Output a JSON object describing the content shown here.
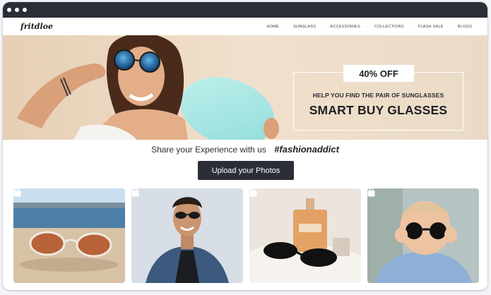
{
  "window": {
    "controls": [
      "dot",
      "dot",
      "dot"
    ]
  },
  "brand": {
    "logo": "fritdloe"
  },
  "nav": {
    "items": [
      "HOME",
      "SUNGLASS",
      "ACCESSORIES",
      "COLLECTIONS",
      "FLASH SALE",
      "BLOGS"
    ],
    "separator": "-"
  },
  "hero": {
    "discount": "40% OFF",
    "subtitle": "HELP YOU FIND THE PAIR OF SUNGLASSES",
    "title": "SMART BUY GLASSES"
  },
  "share": {
    "text": "Share your Experience with us",
    "hashtag": "#fashionaddict",
    "upload_label": "Upload your Photos"
  },
  "gallery": {
    "photos": [
      {
        "subject": "beach-sunglasses",
        "icon": "shopping-bag-icon"
      },
      {
        "subject": "man-sunglasses",
        "icon": "shopping-bag-icon"
      },
      {
        "subject": "perfume-sunglasses",
        "icon": "shopping-bag-icon"
      },
      {
        "subject": "baby-sunglasses",
        "icon": "shopping-bag-icon"
      }
    ]
  },
  "colors": {
    "titlebar": "#2b2e37",
    "button": "#2b2e37",
    "hero_background": "#ecdcc6",
    "text_dark": "#1e1f24"
  }
}
